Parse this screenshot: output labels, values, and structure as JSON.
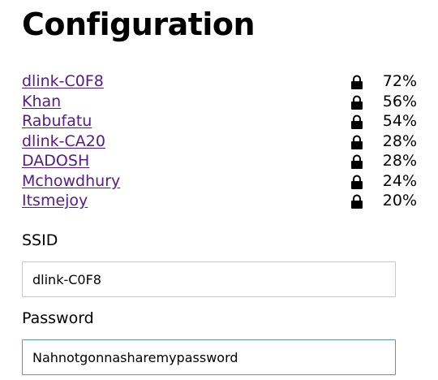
{
  "page": {
    "title": "Configuration"
  },
  "networks": [
    {
      "ssid": "dlink-C0F8",
      "signal": "72%",
      "secured": true
    },
    {
      "ssid": "Khan",
      "signal": "56%",
      "secured": true
    },
    {
      "ssid": "Rabufatu",
      "signal": "54%",
      "secured": true
    },
    {
      "ssid": "dlink-CA20",
      "signal": "28%",
      "secured": true
    },
    {
      "ssid": "DADOSH",
      "signal": "28%",
      "secured": true
    },
    {
      "ssid": "Mchowdhury",
      "signal": "24%",
      "secured": true
    },
    {
      "ssid": "Itsmejoy",
      "signal": "20%",
      "secured": true
    }
  ],
  "form": {
    "ssid_label": "SSID",
    "ssid_value": "dlink-C0F8",
    "password_label": "Password",
    "password_value": "Nahnotgonnasharemypassword"
  },
  "icons": {
    "lock": "lock-icon"
  },
  "colors": {
    "link": "#551a8b",
    "focus_border": "#5a9e9a",
    "input_border": "#c8c8c8"
  }
}
